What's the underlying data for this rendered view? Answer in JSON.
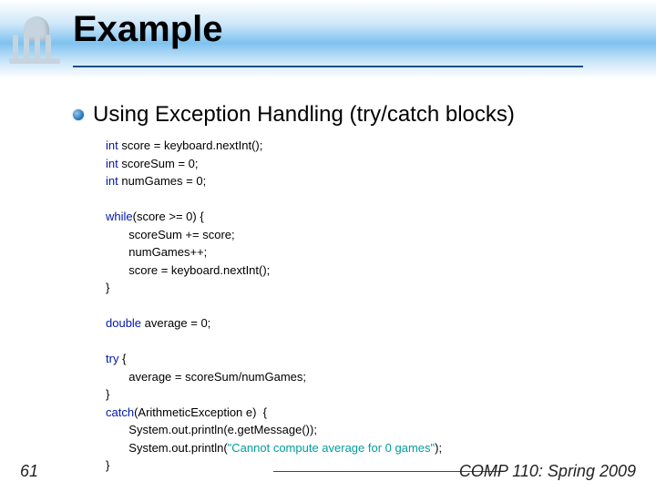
{
  "title": "Example",
  "subtitle": "Using Exception Handling (try/catch blocks)",
  "code": {
    "l1_kw": "int",
    "l1": " score = keyboard.nextInt();",
    "l2_kw": "int",
    "l2": " scoreSum = 0;",
    "l3_kw": "int",
    "l3": " numGames = 0;",
    "l5_kw": "while",
    "l5": "(score >= 0) {",
    "l6": "scoreSum += score;",
    "l7": "numGames++;",
    "l8": "score = keyboard.nextInt();",
    "l9": "}",
    "l11_kw": "double",
    "l11": " average = 0;",
    "l13_kw": "try",
    "l13": " {",
    "l14": "average = scoreSum/numGames;",
    "l15": "}",
    "l16_kw": "catch",
    "l16": "(ArithmeticException e)  {",
    "l17": "System.out.println(e.getMessage());",
    "l18a": "System.out.println(",
    "l18_str": "\"Cannot compute average for 0 games\"",
    "l18b": ");",
    "l19": "}"
  },
  "footer": {
    "page": "61",
    "course": "COMP 110: Spring 2009"
  }
}
